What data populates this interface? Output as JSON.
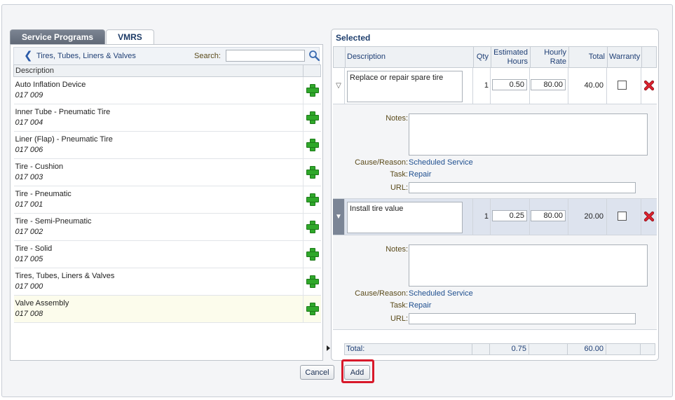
{
  "tabs": [
    {
      "label": "Service Programs",
      "active": false
    },
    {
      "label": "VMRS",
      "active": true
    }
  ],
  "left": {
    "breadcrumb": "Tires, Tubes, Liners & Valves",
    "search_label": "Search:",
    "search_value": "",
    "column_header": "Description",
    "items": [
      {
        "name": "Auto Inflation Device",
        "code": "017 009"
      },
      {
        "name": "Inner Tube - Pneumatic Tire",
        "code": "017 004"
      },
      {
        "name": "Liner (Flap) - Pneumatic Tire",
        "code": "017 006"
      },
      {
        "name": "Tire - Cushion",
        "code": "017 003"
      },
      {
        "name": "Tire - Pneumatic",
        "code": "017 001"
      },
      {
        "name": "Tire - Semi-Pneumatic",
        "code": "017 002"
      },
      {
        "name": "Tire - Solid",
        "code": "017 005"
      },
      {
        "name": "Tires, Tubes, Liners & Valves",
        "code": "017 000"
      },
      {
        "name": "Valve Assembly",
        "code": "017 008"
      }
    ]
  },
  "right": {
    "title": "Selected",
    "headers": {
      "description": "Description",
      "qty": "Qty",
      "est_hours_1": "Estimated",
      "est_hours_2": "Hours",
      "rate_1": "Hourly",
      "rate_2": "Rate",
      "total": "Total",
      "warranty": "Warranty"
    },
    "rows": [
      {
        "marker": "▽",
        "description": "Replace or repair spare tire",
        "qty": "1",
        "hours": "0.50",
        "rate": "80.00",
        "total": "40.00",
        "notes_label": "Notes:",
        "cause_label": "Cause/Reason:",
        "cause_value": "Scheduled Service",
        "task_label": "Task:",
        "task_value": "Repair",
        "url_label": "URL:"
      },
      {
        "marker": "▼",
        "description": "Install tire value",
        "qty": "1",
        "hours": "0.25",
        "rate": "80.00",
        "total": "20.00",
        "notes_label": "Notes:",
        "cause_label": "Cause/Reason:",
        "cause_value": "Scheduled Service",
        "task_label": "Task:",
        "task_value": "Repair",
        "url_label": "URL:"
      }
    ],
    "totals": {
      "label": "Total:",
      "hours": "0.75",
      "amount": "60.00"
    }
  },
  "buttons": {
    "cancel": "Cancel",
    "add": "Add"
  },
  "colors": {
    "accent": "#1f3f75",
    "highlight_box": "#d8192a",
    "add_icon": "#2fa82a",
    "delete_icon": "#d8192a"
  }
}
